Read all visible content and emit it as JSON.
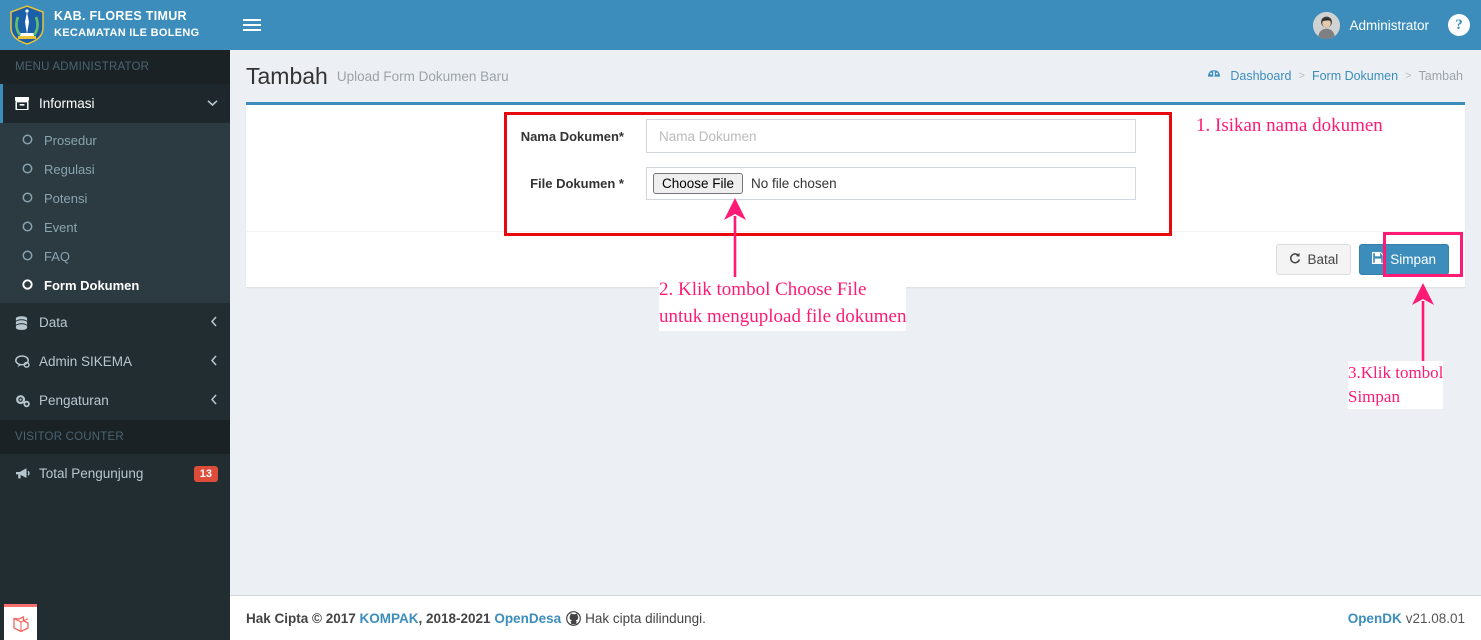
{
  "brand": {
    "line1": "KAB. FLORES TIMUR",
    "line2": "KECAMATAN ILE BOLENG",
    "emblem_icon": "regency-emblem-icon"
  },
  "topbar": {
    "menu_toggle_icon": "hamburger-icon",
    "user_name": "Administrator",
    "avatar_icon": "user-avatar",
    "help_icon": "question-mark-icon",
    "bg_color": "#3c8dbc"
  },
  "sidebar": {
    "menu_header": "MENU ADMINISTRATOR",
    "items": [
      {
        "label": "Informasi",
        "icon": "archive-icon",
        "caret": "chevron-down-icon",
        "active": true
      },
      {
        "label": "Data",
        "icon": "database-icon",
        "caret": "chevron-left-icon",
        "active": false
      },
      {
        "label": "Admin SIKEMA",
        "icon": "comments-icon",
        "caret": "chevron-left-icon",
        "active": false
      },
      {
        "label": "Pengaturan",
        "icon": "gears-icon",
        "caret": "chevron-left-icon",
        "active": false
      }
    ],
    "submenu": [
      {
        "label": "Prosedur",
        "icon": "circle-o-icon",
        "current": false
      },
      {
        "label": "Regulasi",
        "icon": "circle-o-icon",
        "current": false
      },
      {
        "label": "Potensi",
        "icon": "circle-o-icon",
        "current": false
      },
      {
        "label": "Event",
        "icon": "circle-o-icon",
        "current": false
      },
      {
        "label": "FAQ",
        "icon": "circle-o-icon",
        "current": false
      },
      {
        "label": "Form Dokumen",
        "icon": "circle-o-icon",
        "current": true
      }
    ],
    "visitor_header": "VISITOR COUNTER",
    "visitor_item": {
      "label": "Total Pengunjung",
      "icon": "bullhorn-icon",
      "count": "13",
      "count_color": "#dd4b39"
    },
    "laravel_mark_icon": "laravel-logo-icon",
    "bg_color": "#222d32"
  },
  "page": {
    "title": "Tambah",
    "subtitle": "Upload Form Dokumen Baru",
    "breadcrumb": {
      "home_icon": "dashboard-icon",
      "items": [
        "Dashboard",
        "Form Dokumen",
        "Tambah"
      ],
      "separator": ">"
    }
  },
  "form": {
    "fields": [
      {
        "label": "Nama Dokumen*",
        "type": "text",
        "value": "",
        "placeholder": "Nama Dokumen"
      },
      {
        "label": "File Dokumen *",
        "type": "file",
        "button_label": "Choose File",
        "file_status": "No file chosen"
      }
    ],
    "buttons": [
      {
        "label": "Batal",
        "icon": "refresh-icon",
        "style": "default"
      },
      {
        "label": "Simpan",
        "icon": "save-icon",
        "style": "primary"
      }
    ]
  },
  "annotations": {
    "box_form_color": "#e8090c",
    "box_simpan_color": "#ff1a75",
    "arrow_color": "#ff1a75",
    "text_color": "#ff1a75",
    "items": [
      {
        "id": "anno-1",
        "lines": [
          "1.  Isikan  nama  dokumen"
        ]
      },
      {
        "id": "anno-2",
        "lines": [
          "2.  Klik  tombol  Choose  File",
          "untuk  mengupload  file  dokumen"
        ]
      },
      {
        "id": "anno-3",
        "lines": [
          "3.Klik   tombol",
          "Simpan"
        ]
      }
    ]
  },
  "footer": {
    "prefix": "Hak Cipta © 2017 ",
    "link1": "KOMPAK",
    "mid": ", 2018-2021 ",
    "link2": "OpenDesa",
    "github_icon": "github-icon",
    "suffix": " Hak cipta dilindungi.",
    "right_brand": "OpenDK",
    "right_version": "v21.08.01"
  }
}
